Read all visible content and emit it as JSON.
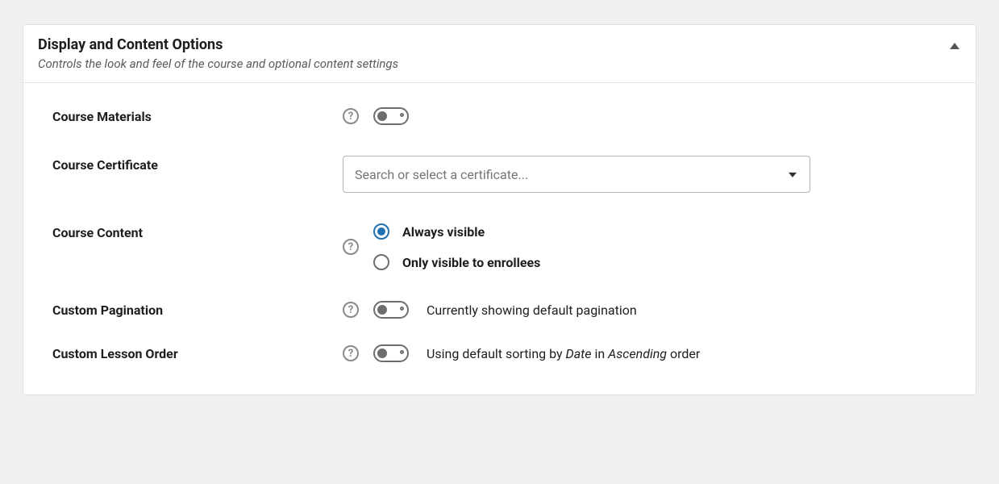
{
  "panel": {
    "title": "Display and Content Options",
    "subtitle": "Controls the look and feel of the course and optional content settings"
  },
  "fields": {
    "course_materials": {
      "label": "Course Materials"
    },
    "course_certificate": {
      "label": "Course Certificate",
      "placeholder": "Search or select a certificate..."
    },
    "course_content": {
      "label": "Course Content",
      "option_visible": "Always visible",
      "option_enrollees": "Only visible to enrollees"
    },
    "custom_pagination": {
      "label": "Custom Pagination",
      "status": "Currently showing default pagination"
    },
    "custom_lesson_order": {
      "label": "Custom Lesson Order",
      "status_prefix": "Using default sorting by ",
      "status_field": "Date",
      "status_middle": " in ",
      "status_direction": "Ascending",
      "status_suffix": " order"
    }
  }
}
